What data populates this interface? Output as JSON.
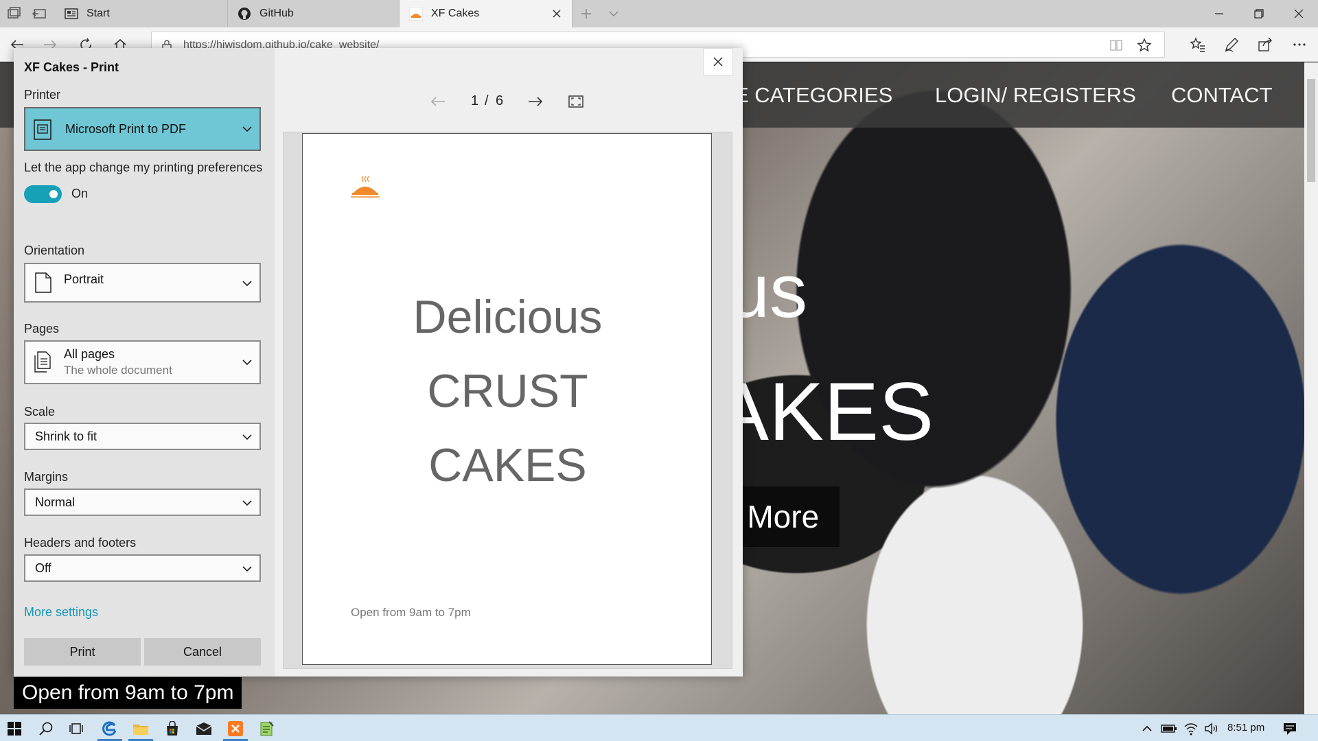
{
  "browser": {
    "tabs": [
      {
        "label": "Start",
        "icon": "start-page-icon"
      },
      {
        "label": "GitHub",
        "icon": "github-icon"
      },
      {
        "label": "XF Cakes",
        "icon": "xf-cakes-favicon",
        "active": true
      }
    ],
    "url": "https://hiwisdom.github.io/cake_website/"
  },
  "site": {
    "nav": [
      "E CATEGORIES",
      "LOGIN/ REGISTERS",
      "CONTACT"
    ],
    "hero_line1": "us",
    "hero_line2": "AKES",
    "hero_button": "e More",
    "open_banner": "Open from 9am to 7pm"
  },
  "print_dialog": {
    "title": "XF Cakes - Print",
    "printer_label": "Printer",
    "printer_value": "Microsoft Print to PDF",
    "pref_label": "Let the app change my printing preferences",
    "pref_state": "On",
    "orientation_label": "Orientation",
    "orientation_value": "Portrait",
    "pages_label": "Pages",
    "pages_value": "All pages",
    "pages_sub": "The whole document",
    "scale_label": "Scale",
    "scale_value": "Shrink to fit",
    "margins_label": "Margins",
    "margins_value": "Normal",
    "headers_label": "Headers and footers",
    "headers_value": "Off",
    "more_settings": "More settings",
    "print_button": "Print",
    "cancel_button": "Cancel",
    "page_current": "1",
    "page_sep": "/",
    "page_total": "6",
    "preview": {
      "line1": "Delicious",
      "line2": "CRUST",
      "line3": "CAKES",
      "footer": "Open from 9am to 7pm"
    }
  },
  "taskbar": {
    "time": "8:51 pm"
  },
  "colors": {
    "accent": "#16a1b8",
    "printer_highlight": "#6fc6d4",
    "link": "#1598b5"
  }
}
